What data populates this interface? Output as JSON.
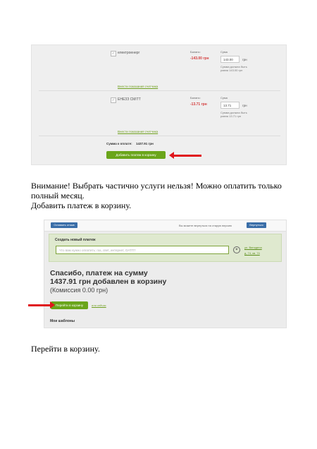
{
  "shot1": {
    "services": [
      {
        "name": "електроенерг",
        "balance_label": "Баланс:",
        "balance_value": "-143.00 грн",
        "sum_label": "Сума",
        "amount": "143.00",
        "currency": "грн",
        "note": "Сумма должна быть равна 143.00 грн",
        "link": "Внести показания счетчика"
      },
      {
        "name": "ЕНЕЗЗ СМІТТ",
        "balance_label": "Баланс:",
        "balance_value": "-13.71 грн",
        "sum_label": "Сума",
        "amount": "13.71",
        "currency": "грн",
        "note": "Сумма должна быть равна 13.71 грн",
        "link": "Внести показания счетчика"
      }
    ],
    "total_label": "Сумма к оплате:",
    "total_value": "1437.91 грн",
    "add_button": "Добавить платеж в корзину"
  },
  "text1": {
    "line1": "Внимание! Выбрать частично услуги нельзя! Можно оплатить только",
    "line2": "полный месяц.",
    "line3": "Добавить платеж в корзину."
  },
  "shot2": {
    "feedback_button": "Оставить отзыв",
    "old_version_text": "Вы можете вернуться на старую версию",
    "return_button": "Вернуться",
    "panel_title": "Создать новый платеж",
    "search_placeholder": "Что вам нужно оплатить: газ, свет, интернет, ОАТП?",
    "address_line1": "ул. Винодела",
    "address_line2": "д. 74, кв. 74",
    "thanks_line1": "Спасибо,  платеж на сумму",
    "thanks_line2": "1437.91 грн  добавлен в корзину",
    "commission": "(Комиссия 0.00 грн)",
    "go_cart_button": "Перейти в корзину",
    "or_pay": "или сейчас",
    "my_templates": "Мои шаблоны"
  },
  "text2": {
    "line1": "Перейти в корзину."
  }
}
